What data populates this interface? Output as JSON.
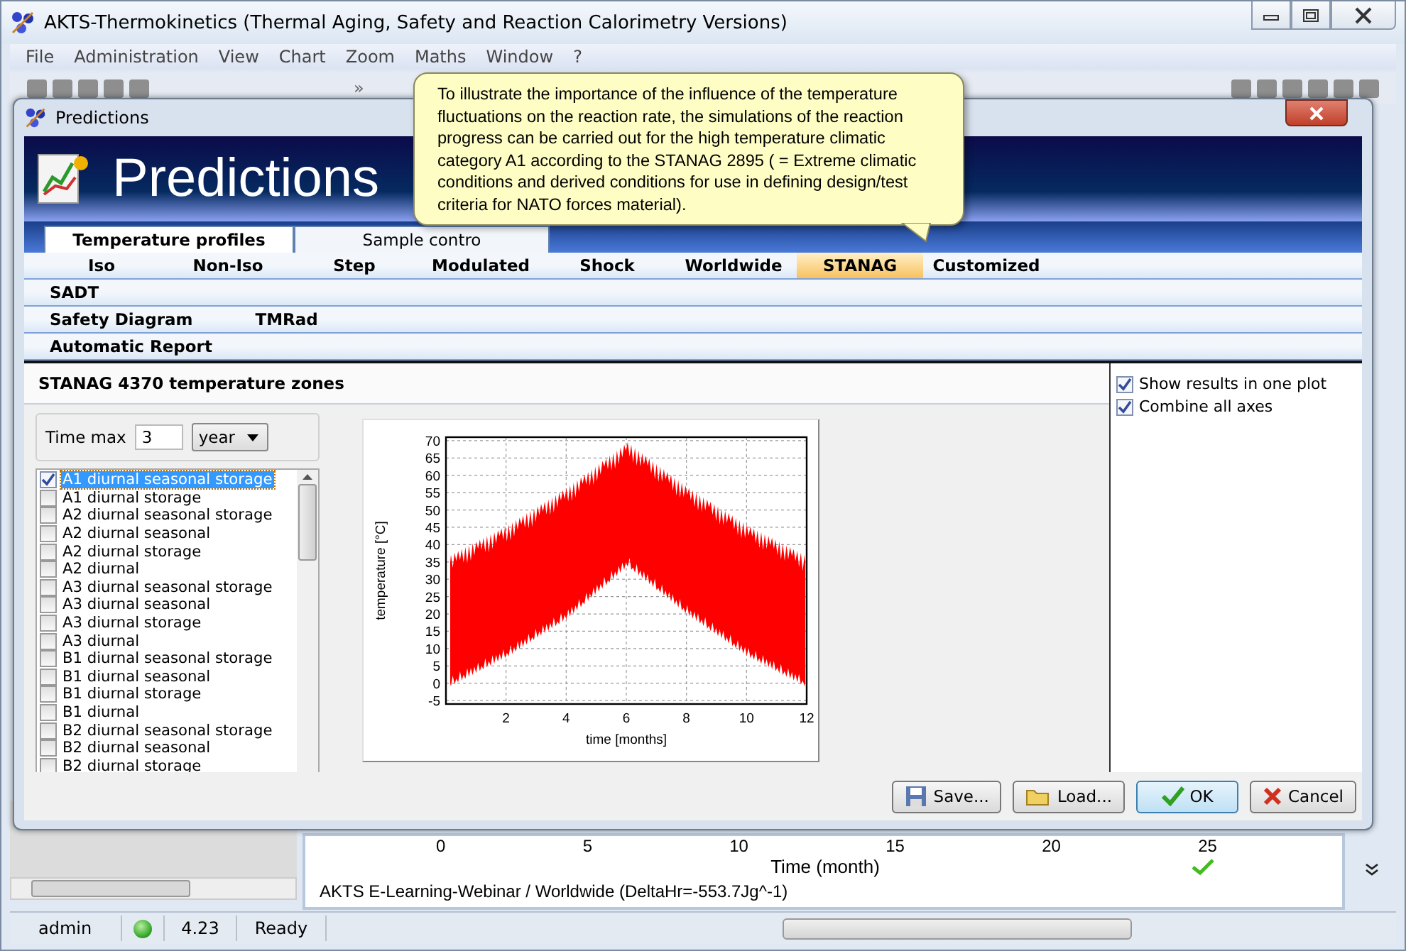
{
  "window": {
    "title": "AKTS-Thermokinetics (Thermal Aging, Safety and Reaction Calorimetry Versions)"
  },
  "menu": [
    "File",
    "Administration",
    "View",
    "Chart",
    "Zoom",
    "Maths",
    "Window",
    "?"
  ],
  "toolbar": {
    "overflow": "»"
  },
  "dialog": {
    "title": "Predictions",
    "banner_title": "Predictions",
    "tabs": [
      {
        "label": "Temperature profiles",
        "selected": true
      },
      {
        "label": "Sample contro",
        "selected": false
      }
    ],
    "nav_rows": [
      [
        {
          "label": "Iso",
          "selected": false
        },
        {
          "label": "Non-Iso",
          "selected": false
        },
        {
          "label": "Step",
          "selected": false
        },
        {
          "label": "Modulated",
          "selected": false
        },
        {
          "label": "Shock",
          "selected": false
        },
        {
          "label": "Worldwide",
          "selected": false
        },
        {
          "label": "STANAG",
          "selected": true
        },
        {
          "label": "Customized",
          "selected": false
        }
      ],
      [
        {
          "label": "SADT",
          "selected": false
        }
      ],
      [
        {
          "label": "Safety Diagram",
          "selected": false
        },
        {
          "label": "TMRad",
          "selected": false
        }
      ],
      [
        {
          "label": "Automatic Report",
          "selected": false
        }
      ]
    ],
    "section_title": "STANAG 4370 temperature zones",
    "time_max": {
      "label": "Time max",
      "value": "3",
      "unit": "year"
    },
    "zones": [
      {
        "label": "A1 diurnal seasonal storage",
        "checked": true,
        "selected": true
      },
      {
        "label": "A1 diurnal storage",
        "checked": false,
        "selected": false
      },
      {
        "label": "A2 diurnal seasonal storage",
        "checked": false,
        "selected": false
      },
      {
        "label": "A2 diurnal seasonal",
        "checked": false,
        "selected": false
      },
      {
        "label": "A2 diurnal storage",
        "checked": false,
        "selected": false
      },
      {
        "label": "A2 diurnal",
        "checked": false,
        "selected": false
      },
      {
        "label": "A3 diurnal seasonal storage",
        "checked": false,
        "selected": false
      },
      {
        "label": "A3 diurnal seasonal",
        "checked": false,
        "selected": false
      },
      {
        "label": "A3 diurnal storage",
        "checked": false,
        "selected": false
      },
      {
        "label": "A3 diurnal",
        "checked": false,
        "selected": false
      },
      {
        "label": "B1 diurnal seasonal storage",
        "checked": false,
        "selected": false
      },
      {
        "label": "B1 diurnal seasonal",
        "checked": false,
        "selected": false
      },
      {
        "label": "B1 diurnal storage",
        "checked": false,
        "selected": false
      },
      {
        "label": "B1 diurnal",
        "checked": false,
        "selected": false
      },
      {
        "label": "B2 diurnal seasonal storage",
        "checked": false,
        "selected": false
      },
      {
        "label": "B2 diurnal seasonal",
        "checked": false,
        "selected": false
      },
      {
        "label": "B2 diurnal storage",
        "checked": false,
        "selected": false
      }
    ],
    "chart_data": {
      "type": "area",
      "xlabel": "time [months]",
      "ylabel": "temperature [°C]",
      "grid": true,
      "xlim": [
        0,
        12
      ],
      "ylim": [
        -6,
        71
      ],
      "xticks": [
        2,
        4,
        6,
        8,
        10,
        12
      ],
      "yticks": [
        -5,
        0,
        5,
        10,
        15,
        20,
        25,
        30,
        35,
        40,
        45,
        50,
        55,
        60,
        65,
        70
      ]
    },
    "options": [
      {
        "label": "Show results in one plot",
        "checked": true
      },
      {
        "label": "Combine all axes",
        "checked": true
      }
    ],
    "buttons": [
      {
        "label": "Save...",
        "kind": "save"
      },
      {
        "label": "Load...",
        "kind": "load"
      },
      {
        "label": "OK",
        "kind": "ok"
      },
      {
        "label": "Cancel",
        "kind": "cancel"
      }
    ]
  },
  "tooltip": "To illustrate the importance of the influence of the temperature fluctuations on the reaction rate, the simulations of the reaction progress can be carried out for the high temperature climatic category A1 according to the STANAG 2895 ( = Extreme climatic conditions and derived conditions for use in defining design/test criteria for NATO forces material).",
  "background_chart": {
    "ticks": [
      "0",
      "5",
      "10",
      "15",
      "20",
      "25"
    ],
    "axis_label": "Time (month)",
    "caption": "AKTS E-Learning-Webinar / Worldwide (DeltaHr=-553.7Jg^-1)"
  },
  "status_bar": {
    "user": "admin",
    "version": "4.23",
    "status": "Ready"
  }
}
